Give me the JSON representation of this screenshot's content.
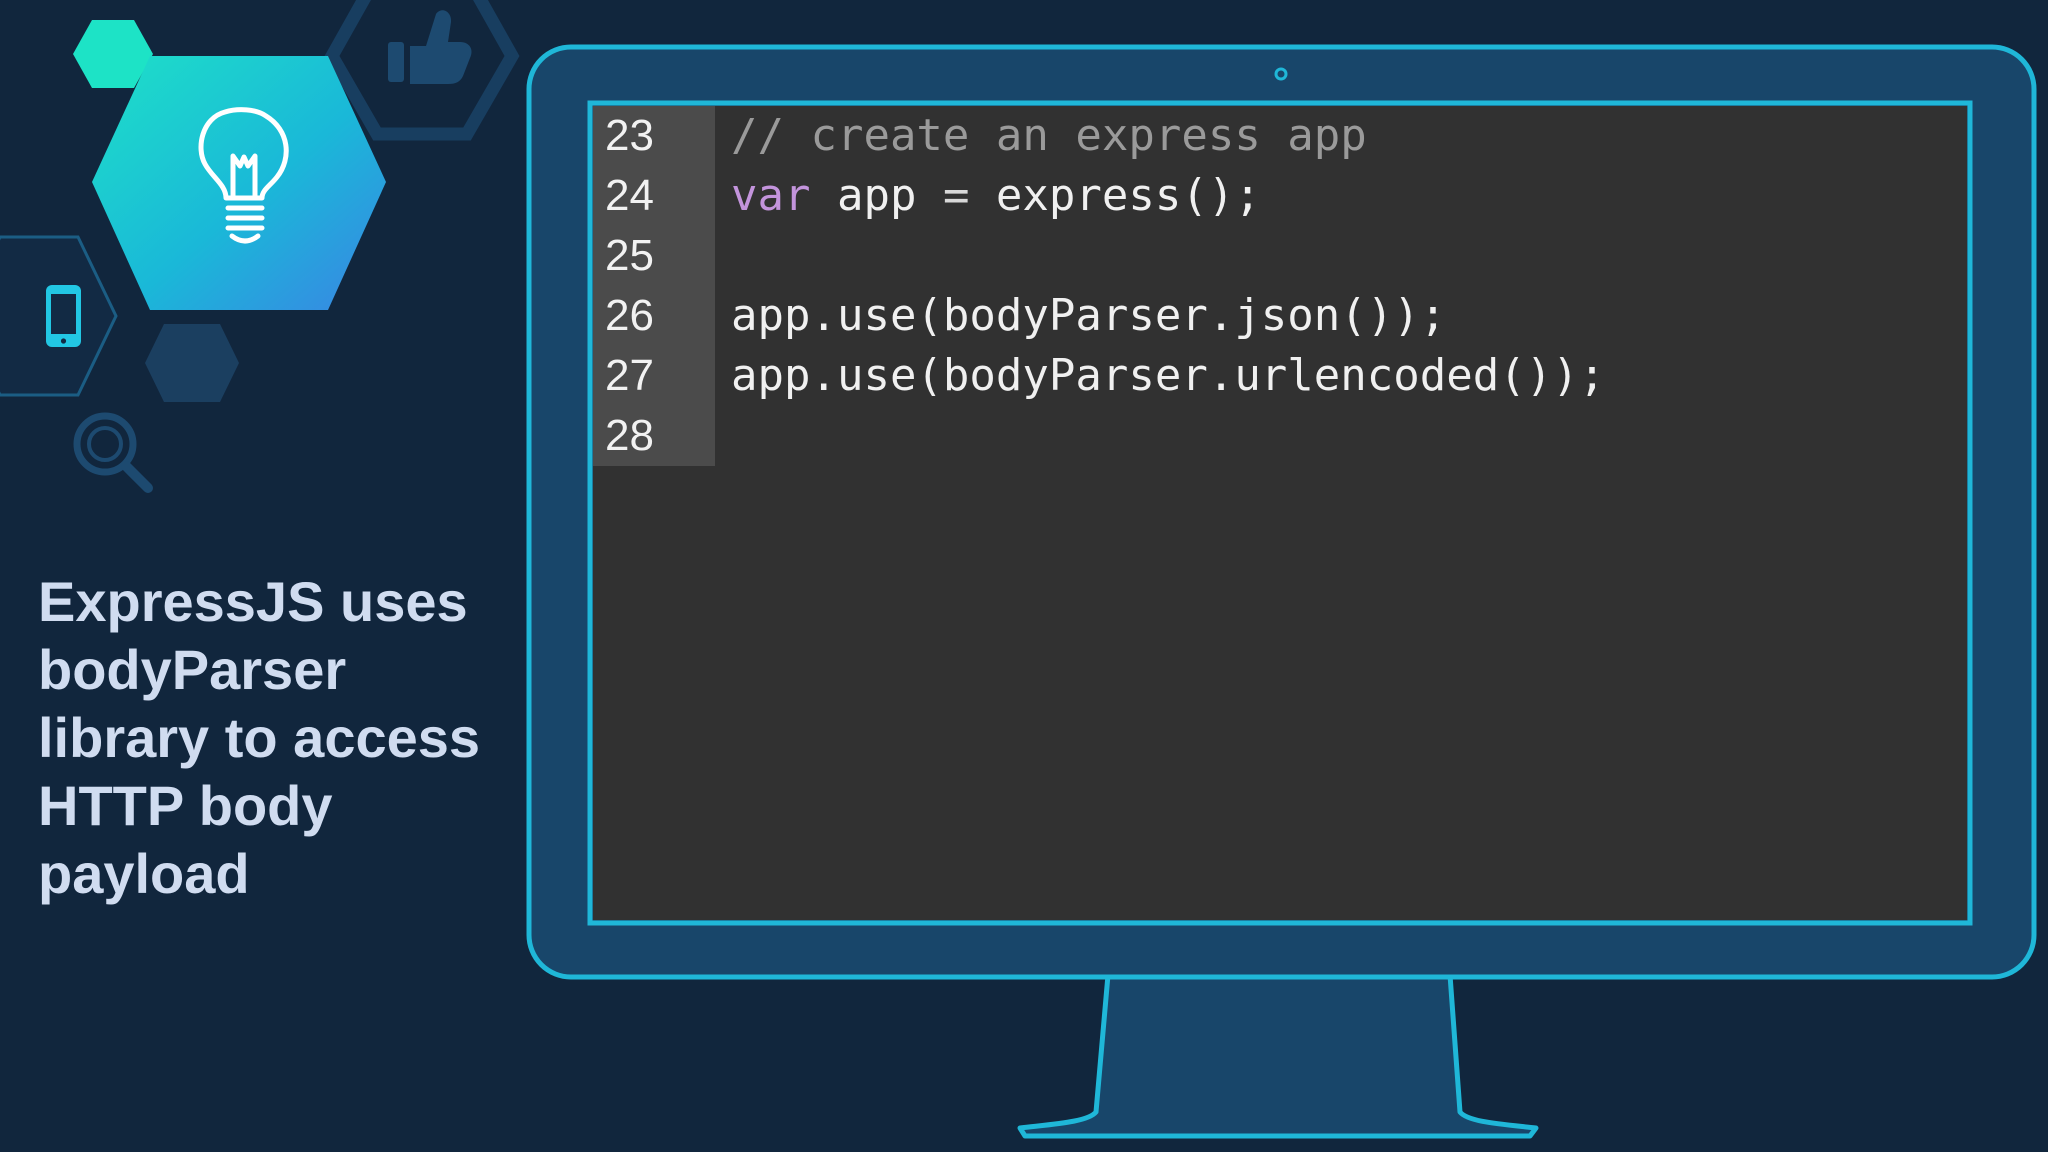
{
  "caption": {
    "lines": [
      "ExpressJS uses",
      "bodyParser",
      "library to access",
      "HTTP body",
      "payload"
    ]
  },
  "code": {
    "lines": [
      {
        "number": "23",
        "tokens": [
          {
            "text": "// create an express app",
            "kind": "comment"
          }
        ]
      },
      {
        "number": "24",
        "tokens": [
          {
            "text": "var",
            "kind": "keyword"
          },
          {
            "text": " app ",
            "kind": "plain"
          },
          {
            "text": "=",
            "kind": "op"
          },
          {
            "text": " express();",
            "kind": "plain"
          }
        ]
      },
      {
        "number": "25",
        "tokens": []
      },
      {
        "number": "26",
        "tokens": [
          {
            "text": "app.use(bodyParser.json());",
            "kind": "plain"
          }
        ]
      },
      {
        "number": "27",
        "tokens": [
          {
            "text": "app.use(bodyParser.urlencoded());",
            "kind": "plain"
          }
        ]
      },
      {
        "number": "28",
        "tokens": []
      }
    ]
  },
  "icons": [
    {
      "name": "lightbulb-icon"
    },
    {
      "name": "thumbs-up-icon"
    },
    {
      "name": "smartphone-icon"
    },
    {
      "name": "magnifier-icon"
    },
    {
      "name": "monitor-icon"
    }
  ],
  "colors": {
    "background": "#11263d",
    "accent": "#1fb7d8",
    "monitor_body": "#18466a",
    "code_background": "#313131",
    "gutter": "#4b4b4b",
    "comment": "#9a9a9a",
    "keyword": "#c394dc",
    "caption_text": "#d0dcf0"
  }
}
